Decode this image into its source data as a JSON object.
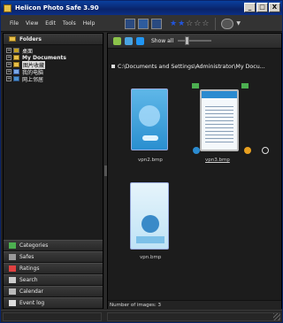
{
  "window": {
    "title": "Helicon Photo Safe 3.90"
  },
  "titlebar_buttons": [
    "_",
    "□",
    "X"
  ],
  "menu": [
    "File",
    "View",
    "Edit",
    "Tools",
    "Help"
  ],
  "rating_stars": {
    "on": 2,
    "total": 5
  },
  "left_panel": {
    "header": "Folders",
    "tree": [
      {
        "label": "桌面",
        "icon": "desktop-icon"
      },
      {
        "label": "My Documents",
        "icon": "documents-folder-icon"
      },
      {
        "label": "图片收藏",
        "icon": "folder-icon",
        "selected": true
      },
      {
        "label": "我的电脑",
        "icon": "computer-icon"
      },
      {
        "label": "网上邻居",
        "icon": "network-icon"
      }
    ],
    "accordion": [
      {
        "label": "Categories",
        "icon": "categories-icon",
        "color": "#4caf50"
      },
      {
        "label": "Safes",
        "icon": "safe-icon",
        "color": "#9a9a9a"
      },
      {
        "label": "Ratings",
        "icon": "star-icon",
        "color": "#e04040"
      },
      {
        "label": "Search",
        "icon": "search-icon",
        "color": "#cccccc"
      },
      {
        "label": "Calendar",
        "icon": "calendar-icon",
        "color": "#bbbbbb"
      },
      {
        "label": "Event log",
        "icon": "event-log-icon",
        "color": "#dddddd"
      }
    ]
  },
  "right_panel": {
    "toolbar": {
      "show_label": "Show all"
    },
    "path": "C:\\Documents and Settings\\Administrator\\My Docu...",
    "thumbnails": [
      {
        "filename": "vpn2.bmp"
      },
      {
        "filename": "vpn3.bmp",
        "selected": true
      },
      {
        "filename": "vpn.bmp"
      }
    ],
    "status": "Number of images: 3"
  },
  "colors": {
    "titlebar": "#0a246a",
    "panel_bg": "#1c1c1c",
    "selection": "#dddddd",
    "star_on": "#2255dd"
  }
}
